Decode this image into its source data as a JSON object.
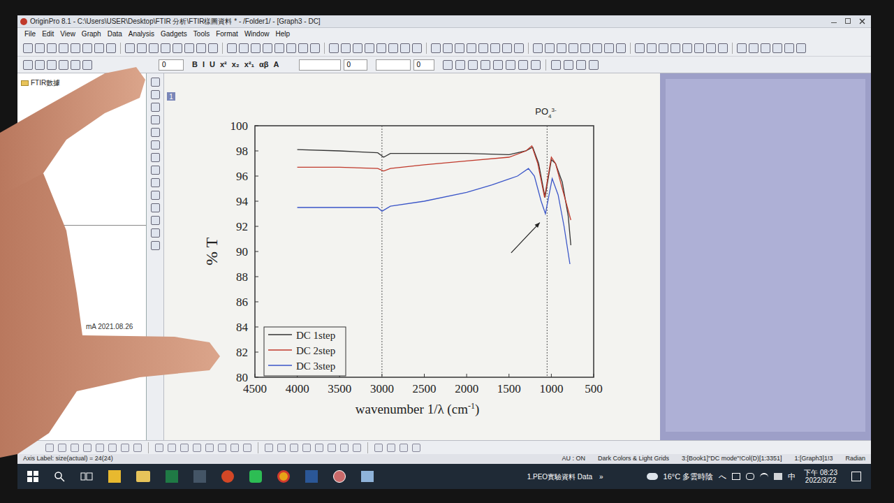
{
  "window": {
    "title": "OriginPro 8.1 - C:\\Users\\USER\\Desktop\\FTIR 分析\\FTIR樣圖資料 * - /Folder1/ - [Graph3 - DC]"
  },
  "menu": [
    "File",
    "Edit",
    "View",
    "Graph",
    "Data",
    "Analysis",
    "Gadgets",
    "Tools",
    "Format",
    "Window",
    "Help"
  ],
  "format_toolbar": {
    "size_a": "0",
    "size_b": "0",
    "size_c": "0",
    "buttons": [
      "B",
      "I",
      "U",
      "x²",
      "x₂",
      "x²₁",
      "αβ",
      "A"
    ]
  },
  "project_explorer": {
    "folder": "FTIR數據",
    "note": "mA 2021.08.26"
  },
  "graph": {
    "page_label": "1",
    "y_label": "% T",
    "x_label": "wavenumber 1/λ (cm",
    "x_label_sup": "-1",
    "x_label_end": ")",
    "annotation": {
      "text": "PO",
      "sub": "4",
      "sup": "3-"
    },
    "arrow": {
      "from": [
        1474,
        89.9
      ],
      "to": [
        1136,
        92.3
      ]
    },
    "guide_lines": [
      3000,
      1050
    ],
    "y_ticks": [
      "100",
      "98",
      "96",
      "94",
      "92",
      "90",
      "88",
      "86",
      "84",
      "82",
      "80"
    ],
    "x_ticks": [
      "4500",
      "4000",
      "3500",
      "3000",
      "2500",
      "2000",
      "1500",
      "1000",
      "500"
    ],
    "series": [
      {
        "label": "DC 1step",
        "color": "#333333",
        "points": [
          [
            4000,
            98.1
          ],
          [
            3500,
            98.0
          ],
          [
            3050,
            97.85
          ],
          [
            2980,
            97.5
          ],
          [
            2900,
            97.8
          ],
          [
            2500,
            97.8
          ],
          [
            2000,
            97.8
          ],
          [
            1500,
            97.7
          ],
          [
            1300,
            98.0
          ],
          [
            1220,
            98.3
          ],
          [
            1150,
            97.0
          ],
          [
            1075,
            94.3
          ],
          [
            1000,
            97.3
          ],
          [
            950,
            97.0
          ],
          [
            870,
            95.5
          ],
          [
            800,
            92.8
          ],
          [
            770,
            90.5
          ]
        ]
      },
      {
        "label": "DC 2step",
        "color": "#c0392b",
        "points": [
          [
            4000,
            96.7
          ],
          [
            3500,
            96.7
          ],
          [
            3050,
            96.6
          ],
          [
            2980,
            96.4
          ],
          [
            2900,
            96.6
          ],
          [
            2500,
            96.9
          ],
          [
            2000,
            97.2
          ],
          [
            1500,
            97.5
          ],
          [
            1300,
            98.0
          ],
          [
            1230,
            98.4
          ],
          [
            1160,
            97.0
          ],
          [
            1080,
            94.3
          ],
          [
            1000,
            97.5
          ],
          [
            950,
            97.0
          ],
          [
            870,
            95.0
          ],
          [
            770,
            92.5
          ]
        ]
      },
      {
        "label": "DC 3step",
        "color": "#3a55c8",
        "points": [
          [
            4000,
            93.5
          ],
          [
            3500,
            93.5
          ],
          [
            3050,
            93.5
          ],
          [
            3000,
            93.2
          ],
          [
            2900,
            93.6
          ],
          [
            2500,
            94.0
          ],
          [
            2000,
            94.7
          ],
          [
            1700,
            95.3
          ],
          [
            1400,
            96.0
          ],
          [
            1270,
            96.6
          ],
          [
            1200,
            96.0
          ],
          [
            1120,
            94.0
          ],
          [
            1070,
            93.0
          ],
          [
            990,
            95.8
          ],
          [
            920,
            94.5
          ],
          [
            850,
            92.0
          ],
          [
            780,
            89.0
          ]
        ]
      }
    ]
  },
  "status_bar": {
    "hint": "Axis Label: size(actual) = 24(24)",
    "items": [
      "AU : ON",
      "Dark Colors & Light Grids",
      "3:[Book1]\"DC mode\"!Col(D)[1:3351]",
      "1:[Graph3]1!3",
      "Radian"
    ]
  },
  "taskbar": {
    "app": "1.PEO實驗資料 Data",
    "overflow": "»",
    "weather": "16°C 多雲時陰",
    "tray_arrow": "へ",
    "ime": "中",
    "time": "下午 08:23",
    "date": "2022/3/22"
  }
}
